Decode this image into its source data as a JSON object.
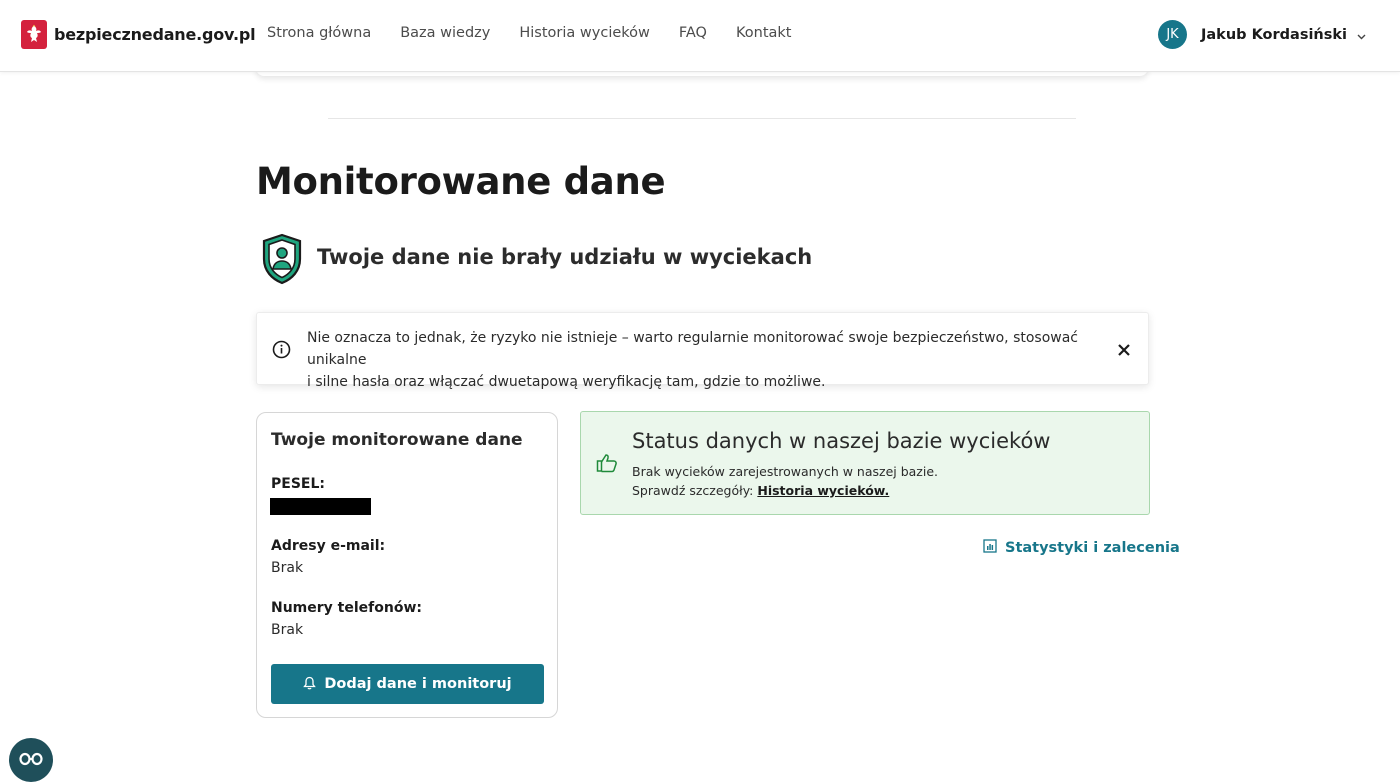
{
  "header": {
    "site_name": "bezpiecznedane.gov.pl",
    "nav": [
      "Strona główna",
      "Baza wiedzy",
      "Historia wycieków",
      "FAQ",
      "Kontakt"
    ],
    "user_initials": "JK",
    "user_name": "Jakub Kordasiński"
  },
  "main": {
    "title": "Monitorowane dane",
    "status_heading": "Twoje dane nie brały udziału w wyciekach",
    "info_line1": "Nie oznacza to jednak, że ryzyko nie istnieje – warto regularnie monitorować swoje bezpieczeństwo, stosować unikalne",
    "info_line2": "i silne hasła oraz włączać dwuetapową weryfikację tam, gdzie to możliwe."
  },
  "monitored": {
    "title": "Twoje monitorowane dane",
    "pesel_label": "PESEL:",
    "email_label": "Adresy e-mail:",
    "email_value": "Brak",
    "phone_label": "Numery telefonów:",
    "phone_value": "Brak",
    "add_button": "Dodaj dane i monitoruj"
  },
  "status": {
    "title": "Status danych w naszej bazie wycieków",
    "line1": "Brak wycieków zarejestrowanych w naszej bazie.",
    "line2_prefix": "Sprawdź szczegóły: ",
    "line2_link": "Historia wycieków."
  },
  "stats_link": "Statystyki i zalecenia",
  "icons": {
    "logo": "polish-eagle-logo",
    "shield": "shield-user-icon",
    "info": "info-icon",
    "close": "close-icon",
    "thumb": "thumbs-up-icon",
    "bell": "bell-icon",
    "stats": "chart-icon",
    "fab": "glasses-icon"
  },
  "colors": {
    "accent": "#17768a",
    "success_bg": "#ebf7ec",
    "success_border": "#a9d7ad",
    "shield_green": "#1fa57f",
    "logo_red": "#d4213d"
  }
}
